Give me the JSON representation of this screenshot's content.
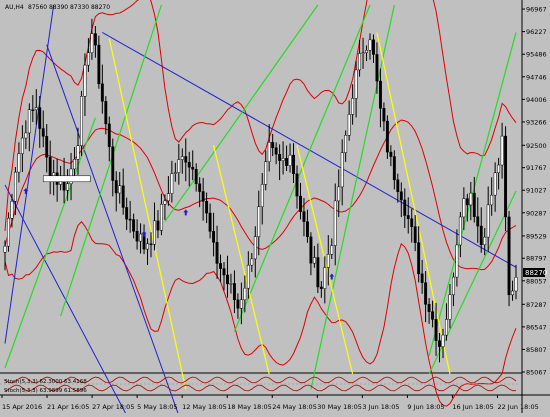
{
  "header": {
    "symbol": "AU,H4",
    "ohlc": "87560 88390 87330 88270"
  },
  "price_axis": {
    "labels": [
      "96967",
      "96227",
      "95486",
      "94746",
      "94006",
      "93266",
      "92500",
      "91767",
      "91027",
      "90287",
      "89529",
      "88797",
      "88057",
      "87287",
      "86547",
      "85807",
      "85067"
    ],
    "current": "88270"
  },
  "time_axis": {
    "labels": [
      "15 Apr 2016",
      "21 Apr 16:05",
      "27 Apr 18:05",
      "5 May 18:05",
      "12 May 18:05",
      "18 May 18:05",
      "24 May 18:05",
      "30 May 18:05",
      "3 Jun 18:05",
      "9 Jun 18:05",
      "16 Jun 18:05",
      "22 Jun 18:05"
    ]
  },
  "indicators": {
    "row1": "Stoch(5,3,3) 62.3000 63.4168",
    "row2": "Stoch(5,3,3) 63.9899 61.5896"
  },
  "chart_data": {
    "type": "candlestick",
    "title": "",
    "symbol": "AU,H4",
    "ylim": [
      85067,
      97100
    ],
    "y_ticks": [
      96967,
      96227,
      95486,
      94746,
      94006,
      93266,
      92500,
      91767,
      91027,
      90287,
      89529,
      88797,
      88057,
      87287,
      86547,
      85807,
      85067
    ],
    "x_ticks": [
      "15 Apr 2016",
      "21 Apr 16:05",
      "27 Apr 18:05",
      "5 May 18:05",
      "12 May 18:05",
      "18 May 18:05",
      "24 May 18:05",
      "30 May 18:05",
      "3 Jun 18:05",
      "9 Jun 18:05",
      "16 Jun 18:05",
      "22 Jun 18:05"
    ],
    "last_price": 88270,
    "close_path": [
      {
        "i": 0,
        "c": 89200
      },
      {
        "i": 3,
        "c": 91800
      },
      {
        "i": 6,
        "c": 93200
      },
      {
        "i": 9,
        "c": 93800
      },
      {
        "i": 12,
        "c": 92000
      },
      {
        "i": 15,
        "c": 91400
      },
      {
        "i": 18,
        "c": 91200
      },
      {
        "i": 21,
        "c": 92800
      },
      {
        "i": 24,
        "c": 95800
      },
      {
        "i": 25,
        "c": 96200
      },
      {
        "i": 28,
        "c": 94000
      },
      {
        "i": 31,
        "c": 91500
      },
      {
        "i": 34,
        "c": 90500
      },
      {
        "i": 37,
        "c": 89800
      },
      {
        "i": 40,
        "c": 89200
      },
      {
        "i": 44,
        "c": 89900
      },
      {
        "i": 48,
        "c": 91500
      },
      {
        "i": 52,
        "c": 92200
      },
      {
        "i": 56,
        "c": 91300
      },
      {
        "i": 60,
        "c": 89000
      },
      {
        "i": 64,
        "c": 88000
      },
      {
        "i": 67,
        "c": 87200
      },
      {
        "i": 70,
        "c": 88400
      },
      {
        "i": 73,
        "c": 90300
      },
      {
        "i": 76,
        "c": 92300
      },
      {
        "i": 79,
        "c": 91900
      },
      {
        "i": 82,
        "c": 92300
      },
      {
        "i": 85,
        "c": 90400
      },
      {
        "i": 88,
        "c": 88800
      },
      {
        "i": 91,
        "c": 87900
      },
      {
        "i": 94,
        "c": 89500
      },
      {
        "i": 97,
        "c": 92000
      },
      {
        "i": 100,
        "c": 94300
      },
      {
        "i": 103,
        "c": 95700
      },
      {
        "i": 105,
        "c": 96200
      },
      {
        "i": 108,
        "c": 93600
      },
      {
        "i": 111,
        "c": 91900
      },
      {
        "i": 114,
        "c": 91000
      },
      {
        "i": 117,
        "c": 89600
      },
      {
        "i": 120,
        "c": 88000
      },
      {
        "i": 123,
        "c": 86800
      },
      {
        "i": 125,
        "c": 86000
      },
      {
        "i": 128,
        "c": 87400
      },
      {
        "i": 131,
        "c": 90500
      },
      {
        "i": 134,
        "c": 91000
      },
      {
        "i": 137,
        "c": 89300
      },
      {
        "i": 140,
        "c": 90900
      },
      {
        "i": 143,
        "c": 92500
      },
      {
        "i": 145,
        "c": 87500
      },
      {
        "i": 147,
        "c": 88270
      }
    ],
    "overlays": {
      "bollinger_bands": "red",
      "trend_lines": [
        "blue",
        "green",
        "yellow"
      ]
    },
    "subwindow": {
      "indicator": "Stochastic",
      "params": "5,3,3",
      "row1_values": [
        62.3,
        63.4168
      ],
      "row2_values": [
        63.9899,
        61.5896
      ]
    },
    "grid": false,
    "legend": "none",
    "colors": {
      "background": "#c0c0c0",
      "bull": "#ffffff",
      "bear": "#000000",
      "bands": "#e00000",
      "trend_blue": "#2020d0",
      "trend_green": "#22dd22",
      "trend_yellow": "#ffff00",
      "stoch_lines": "#b00000",
      "price_tag": "#000000"
    }
  }
}
